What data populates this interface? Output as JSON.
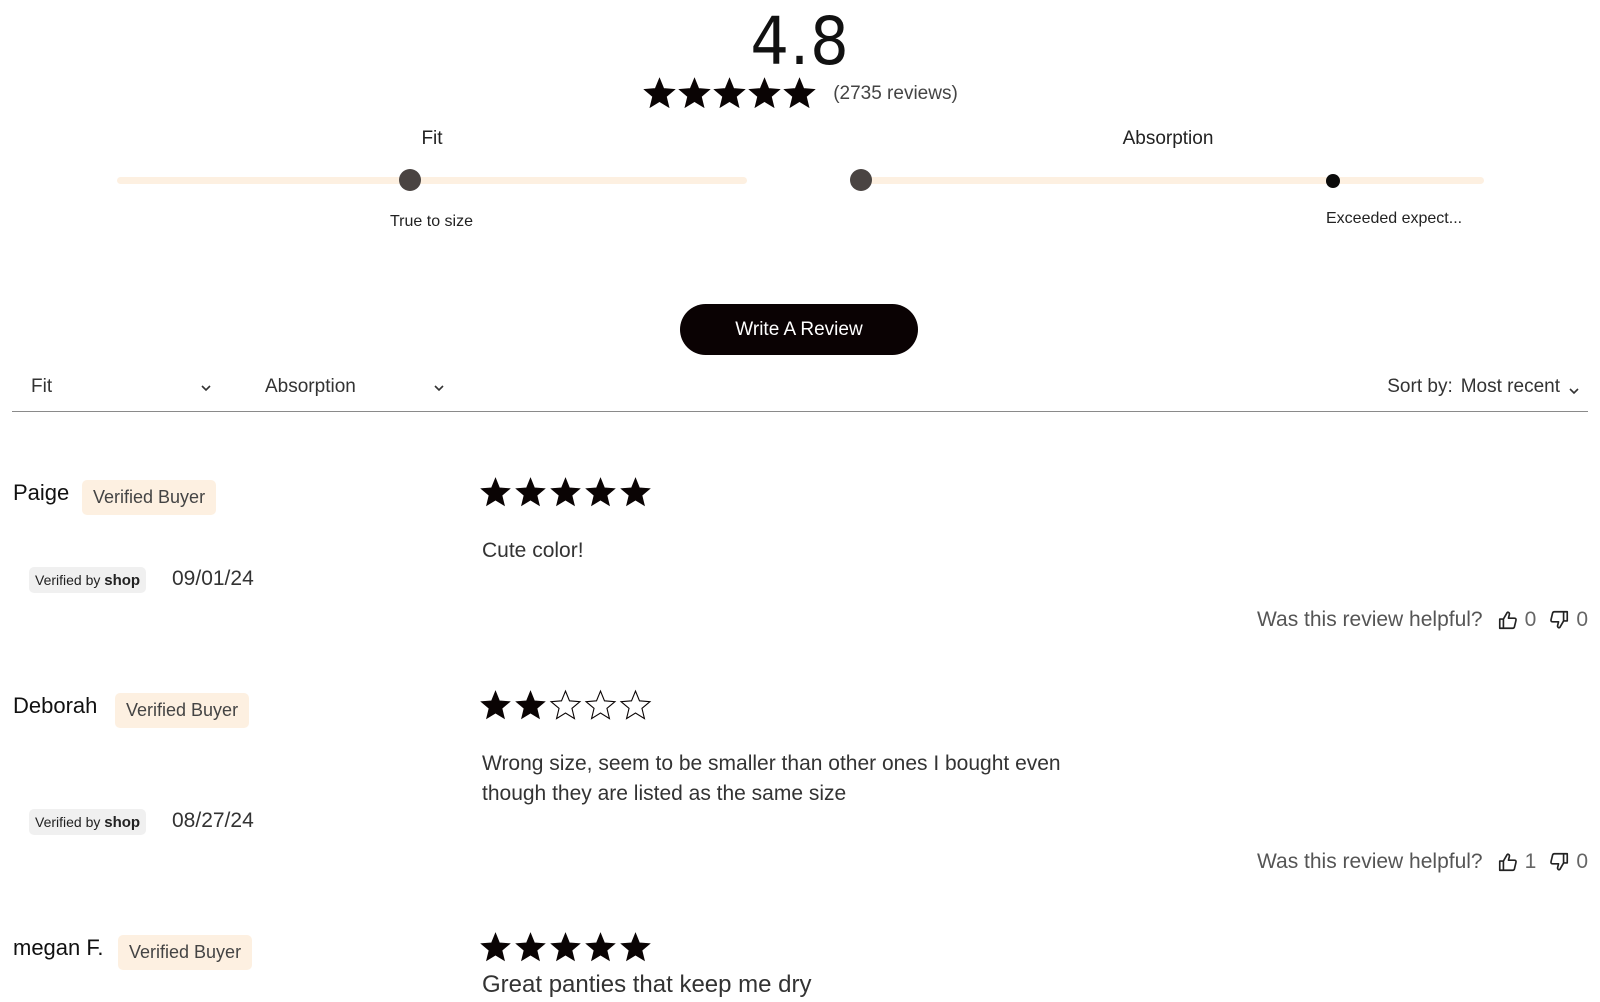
{
  "summary": {
    "average_rating": "4.8",
    "average_rating_value": 4.8,
    "stars_filled": 5,
    "review_count_text": "(2735 reviews)"
  },
  "sliders": [
    {
      "title": "Fit",
      "value_label": "True to size",
      "position": 0.47
    },
    {
      "title": "Absorption",
      "value_label": "Exceeded expect...",
      "position": 0.75
    }
  ],
  "write_review_label": "Write A Review",
  "filters": {
    "fit_label": "Fit",
    "absorption_label": "Absorption",
    "sort_prefix": "Sort by:",
    "sort_value": "Most recent"
  },
  "colors": {
    "badge_bg": "#fdf0e1",
    "track": "#fdf0e1",
    "knob": "#4a4442",
    "button_bg": "#0a0203"
  },
  "reviews": [
    {
      "name": "Paige",
      "badge": "Verified Buyer",
      "verified_by": "Verified by",
      "shop": "shop",
      "date": "09/01/24",
      "rating": 5,
      "body": "Cute color!",
      "helpful_question": "Was this review helpful?",
      "thumbs_up": "0",
      "thumbs_down": "0"
    },
    {
      "name": "Deborah",
      "badge": "Verified Buyer",
      "verified_by": "Verified by",
      "shop": "shop",
      "date": "08/27/24",
      "rating": 2,
      "body_line1": "Wrong size, seem to be smaller than other ones I bought even",
      "body_line2": "though they are listed as the same size",
      "helpful_question": "Was this review helpful?",
      "thumbs_up": "1",
      "thumbs_down": "0"
    },
    {
      "name": "megan F.",
      "badge": "Verified Buyer",
      "rating": 5,
      "body": "Great panties that keep me dry"
    }
  ]
}
